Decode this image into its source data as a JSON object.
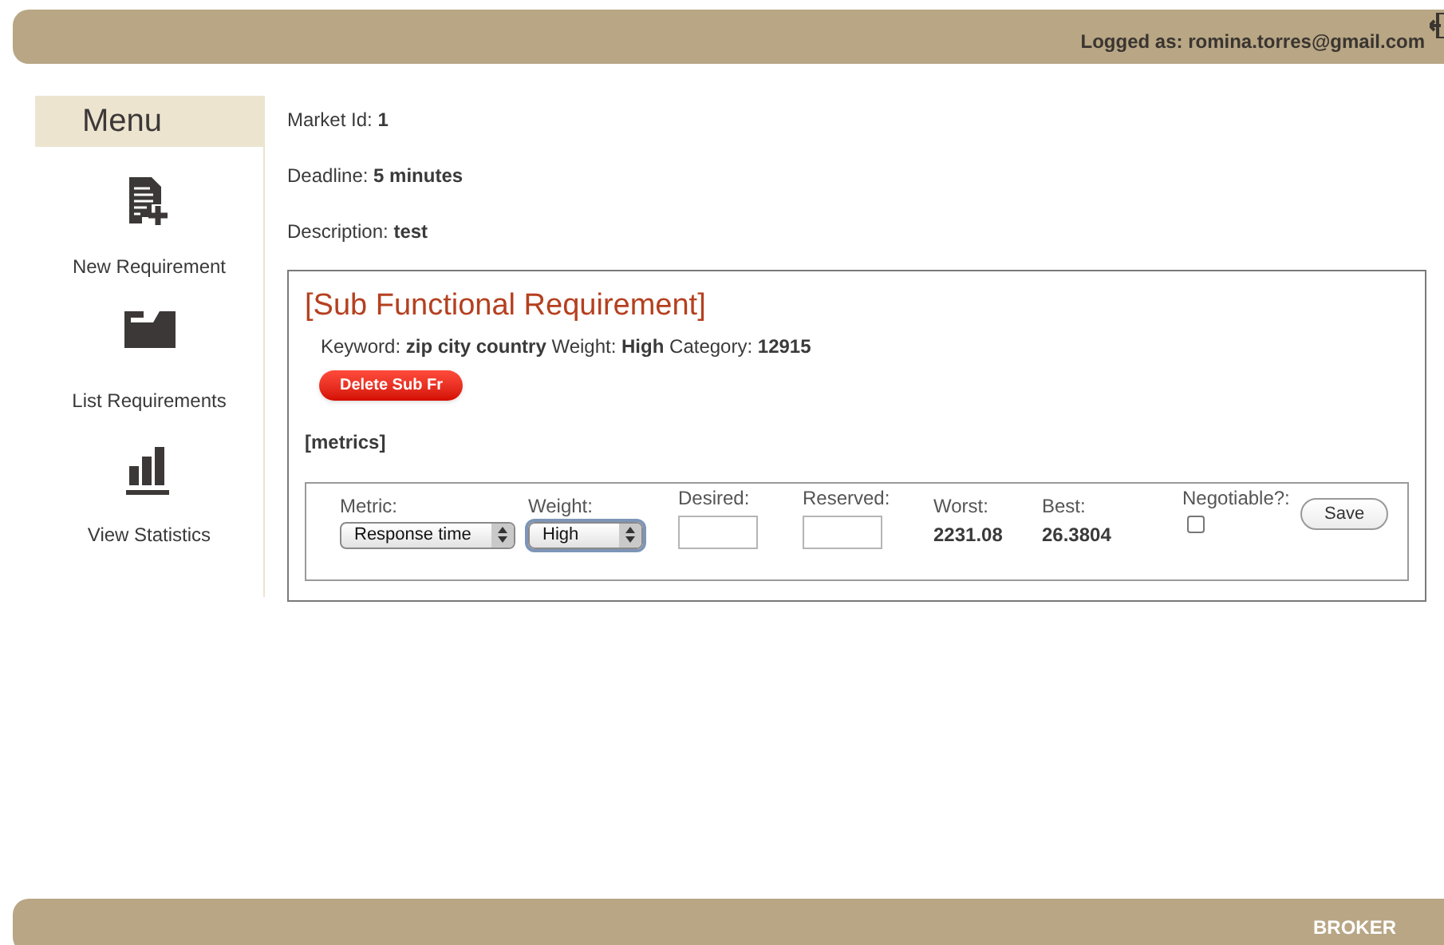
{
  "header": {
    "logged_as": "Logged as: romina.torres@gmail.com"
  },
  "menu": {
    "title": "Menu",
    "items": [
      {
        "label": "New Requirement",
        "kind": "new"
      },
      {
        "label": "List Requirements",
        "kind": "list"
      },
      {
        "label": "View Statistics",
        "kind": "stats"
      }
    ]
  },
  "market": [
    "Market Id: **1**",
    "Deadline: **5 minutes**",
    "Description: **test**"
  ],
  "sub_requirement": {
    "title": "[Sub Functional Requirement]",
    "details": "Keyword: **zip city country** Weight: **High** Category: **12915**",
    "delete_button": "Delete Sub Fr",
    "metrics_label": "[metrics]",
    "metric_row": {
      "metric_label": "Metric:",
      "metric_value": "Response time",
      "weight_label": "Weight:",
      "weight_value": "High",
      "weight_focused": true,
      "desired_label": "Desired:",
      "reserved_label": "Reserved:",
      "worst_label": "Worst:",
      "worst_value": "2231.08",
      "best_label": "Best:",
      "best_value": "26.3804",
      "negotiable_label": "Negotiable?:",
      "negotiable_checked": false,
      "save_button": "Save"
    }
  },
  "footer": {
    "role": "BROKER"
  }
}
